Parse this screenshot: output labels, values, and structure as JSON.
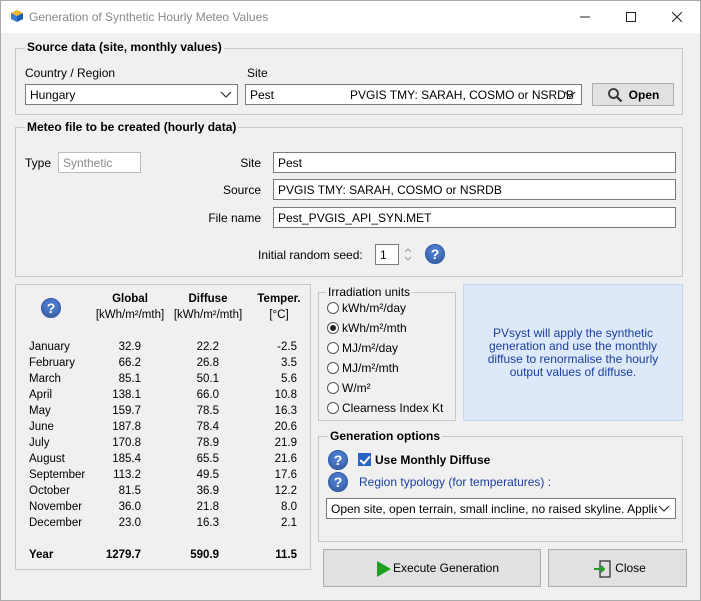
{
  "window": {
    "title": "Generation of Synthetic Hourly Meteo Values"
  },
  "source": {
    "group_title": "Source data (site, monthly values)",
    "country_label": "Country / Region",
    "country_value": "Hungary",
    "site_label": "Site",
    "site_value": "Pest",
    "site_source": "PVGIS TMY: SARAH, COSMO or NSRDB",
    "open_label": "Open"
  },
  "meteo_file": {
    "group_title": "Meteo file to be created (hourly data)",
    "type_label": "Type",
    "type_value": "Synthetic",
    "site_label": "Site",
    "site_value": "Pest",
    "source_label": "Source",
    "source_value": "PVGIS TMY: SARAH, COSMO or NSRDB",
    "filename_label": "File name",
    "filename_value": "Pest_PVGIS_API_SYN.MET",
    "seed_label": "Initial random seed:",
    "seed_value": "1"
  },
  "table": {
    "headers": [
      "Global",
      "Diffuse",
      "Temper."
    ],
    "units": [
      "[kWh/m²/mth]",
      "[kWh/m²/mth]",
      "[°C]"
    ],
    "rows": [
      {
        "month": "January",
        "global": "32.9",
        "diffuse": "22.2",
        "temp": "-2.5"
      },
      {
        "month": "February",
        "global": "66.2",
        "diffuse": "26.8",
        "temp": "3.5"
      },
      {
        "month": "March",
        "global": "85.1",
        "diffuse": "50.1",
        "temp": "5.6"
      },
      {
        "month": "April",
        "global": "138.1",
        "diffuse": "66.0",
        "temp": "10.8"
      },
      {
        "month": "May",
        "global": "159.7",
        "diffuse": "78.5",
        "temp": "16.3"
      },
      {
        "month": "June",
        "global": "187.8",
        "diffuse": "78.4",
        "temp": "20.6"
      },
      {
        "month": "July",
        "global": "170.8",
        "diffuse": "78.9",
        "temp": "21.9"
      },
      {
        "month": "August",
        "global": "185.4",
        "diffuse": "65.5",
        "temp": "21.6"
      },
      {
        "month": "September",
        "global": "113.2",
        "diffuse": "49.5",
        "temp": "17.6"
      },
      {
        "month": "October",
        "global": "81.5",
        "diffuse": "36.9",
        "temp": "12.2"
      },
      {
        "month": "November",
        "global": "36.0",
        "diffuse": "21.8",
        "temp": "8.0"
      },
      {
        "month": "December",
        "global": "23.0",
        "diffuse": "16.3",
        "temp": "2.1"
      }
    ],
    "year": {
      "month": "Year",
      "global": "1279.7",
      "diffuse": "590.9",
      "temp": "11.5"
    }
  },
  "units": {
    "group_title": "Irradiation units",
    "options": [
      "kWh/m²/day",
      "kWh/m²/mth",
      "MJ/m²/day",
      "MJ/m²/mth",
      "W/m²",
      "Clearness Index Kt"
    ],
    "selected": "kWh/m²/mth"
  },
  "info": {
    "text": "PVsyst will apply the synthetic generation and use the monthly diffuse to renormalise the hourly output values of diffuse."
  },
  "generation": {
    "group_title": "Generation options",
    "use_monthly_diffuse_label": "Use Monthly Diffuse",
    "use_monthly_diffuse_checked": true,
    "region_label": "Region typology (for temperatures) :",
    "region_value": "Open site, open terrain, small incline, no raised skyline. Applies to mo"
  },
  "actions": {
    "execute_label": "Execute Generation",
    "close_label": "Close"
  },
  "colors": {
    "accent": "#2a64c5",
    "info_bg": "#dde8f8",
    "info_text": "#1a3fa0",
    "execute_icon": "#1ea01e"
  }
}
